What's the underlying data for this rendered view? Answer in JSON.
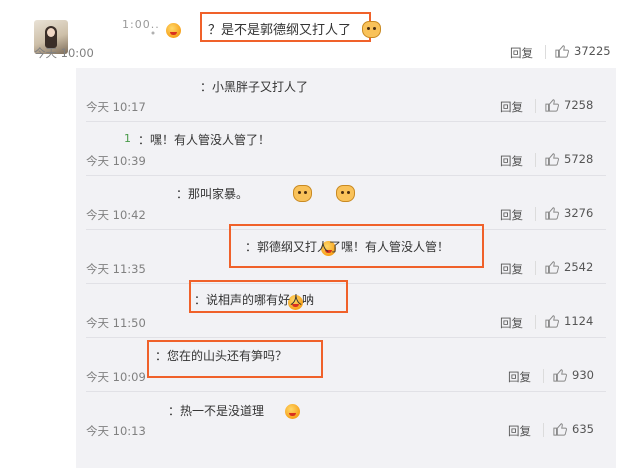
{
  "main_comment": {
    "username": "1:00..",
    "text": "？是不是郭德纲又打人了",
    "time": "今天 10:00",
    "reply_label": "回复",
    "likes": "37225"
  },
  "replies": [
    {
      "username": "",
      "text": "：小黑胖子又打人了",
      "time": "今天 10:17",
      "reply_label": "回复",
      "likes": "7258"
    },
    {
      "username": "1",
      "text": "：嘿！有人管没人管了！",
      "time": "今天 10:39",
      "reply_label": "回复",
      "likes": "5728"
    },
    {
      "username": "",
      "text": "：那叫家暴。",
      "time": "今天 10:42",
      "reply_label": "回复",
      "likes": "3276"
    },
    {
      "username": "",
      "text": "：郭德纲又打人了嘿！有人管没人管！",
      "time": "今天 11:35",
      "reply_label": "回复",
      "likes": "2542"
    },
    {
      "username": "",
      "text": "：说相声的哪有好人呐",
      "time": "今天 11:50",
      "reply_label": "回复",
      "likes": "1124"
    },
    {
      "username": "",
      "text": "：您在的山头还有笋吗？",
      "time": "今天 10:09",
      "reply_label": "回复",
      "likes": "930"
    },
    {
      "username": "",
      "text": "：热一不是没道理",
      "time": "今天 10:13",
      "reply_label": "回复",
      "likes": "635"
    }
  ],
  "colors": {
    "highlight": "#f0612a",
    "thread_bg": "#f2f2f5"
  },
  "icons": {
    "like": "thumbs-up-icon",
    "emoji": "emoji-icon"
  }
}
